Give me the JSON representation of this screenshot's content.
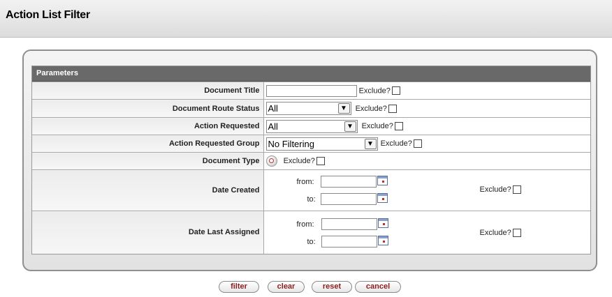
{
  "page": {
    "title": "Action List Filter"
  },
  "params": {
    "heading": "Parameters",
    "exclude_label": "Exclude?",
    "document_title": {
      "label": "Document Title",
      "value": ""
    },
    "route_status": {
      "label": "Document Route Status",
      "selected": "All"
    },
    "action_requested": {
      "label": "Action Requested",
      "selected": "All"
    },
    "action_group": {
      "label": "Action Requested Group",
      "selected": "No Filtering"
    },
    "document_type": {
      "label": "Document Type"
    },
    "date_created": {
      "label": "Date Created",
      "from_label": "from:",
      "to_label": "to:"
    },
    "date_assigned": {
      "label": "Date Last Assigned",
      "from_label": "from:",
      "to_label": "to:"
    }
  },
  "buttons": {
    "filter": "filter",
    "clear": "clear",
    "reset": "reset",
    "cancel": "cancel"
  }
}
